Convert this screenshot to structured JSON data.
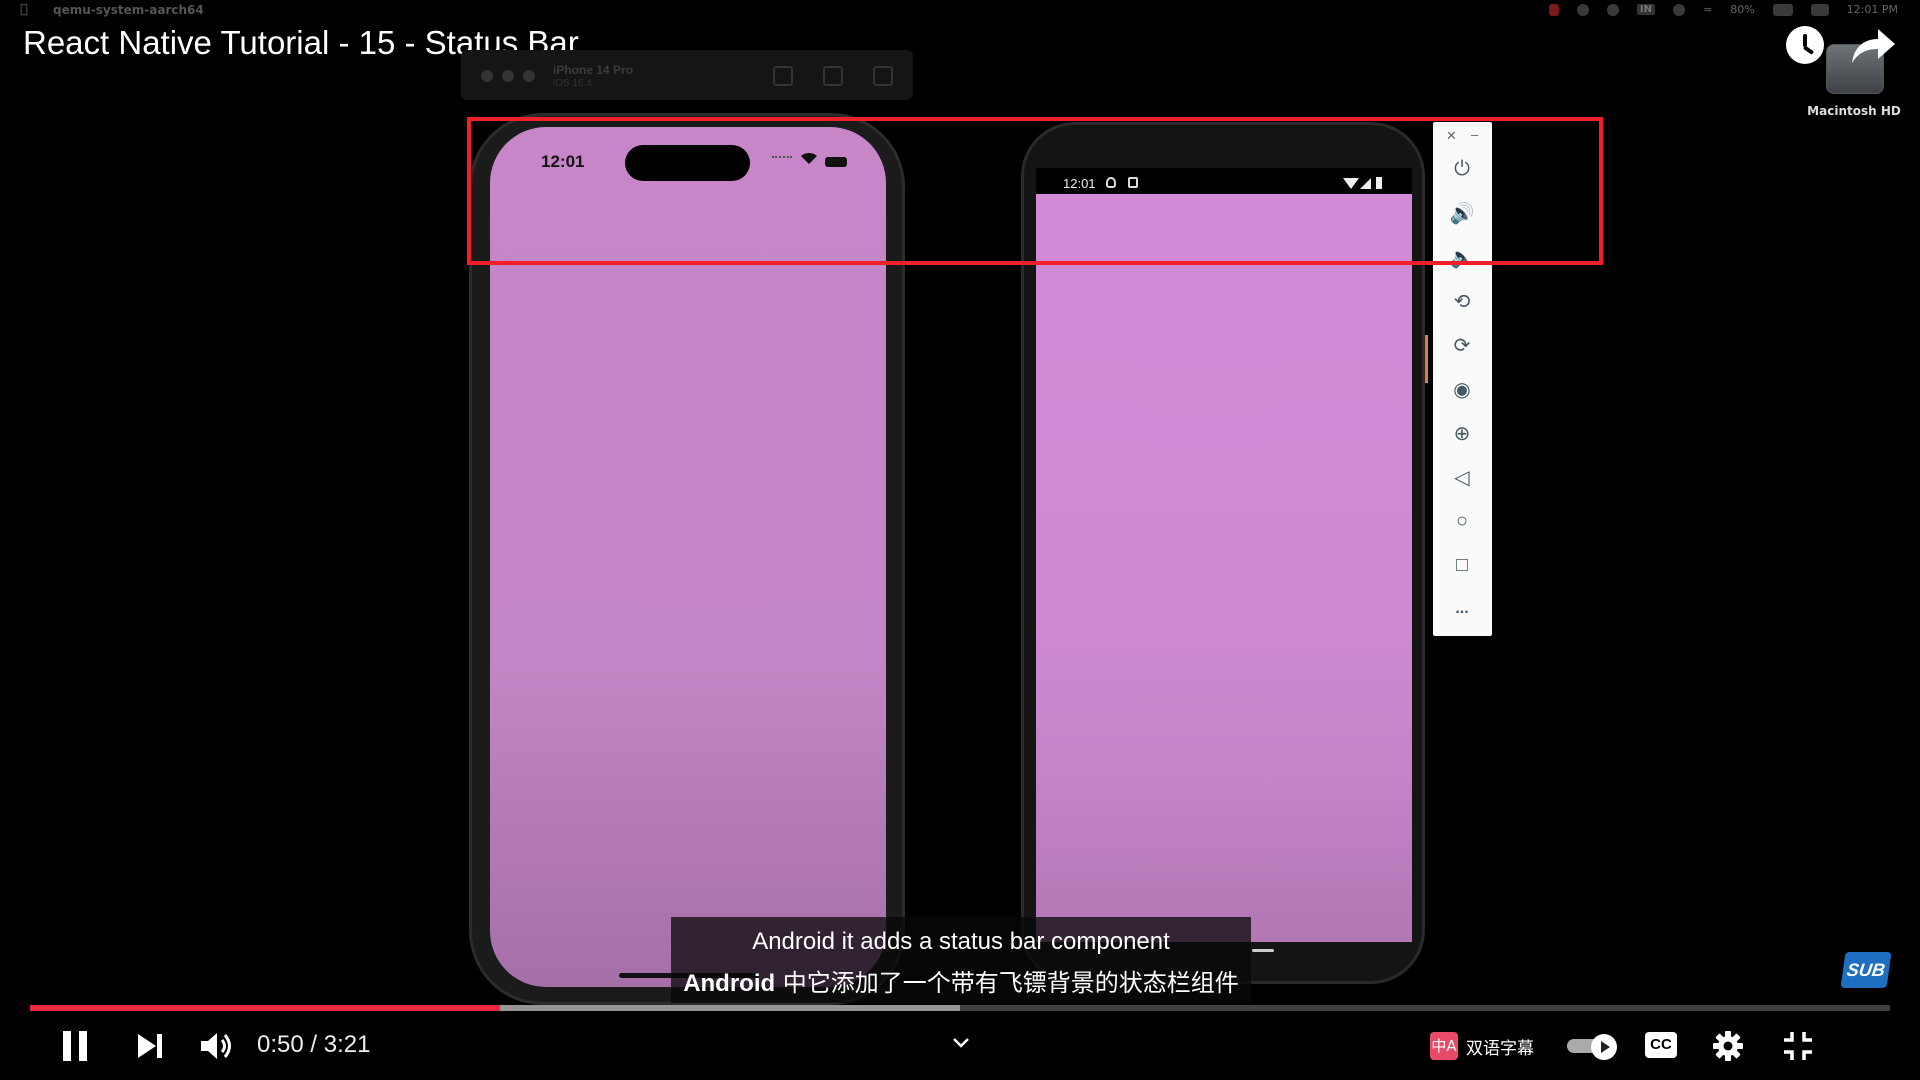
{
  "menubar": {
    "app_name": "qemu-system-aarch64",
    "battery": "80%",
    "clock": "12:01 PM",
    "input_indicator": "IN"
  },
  "video": {
    "title": "React Native Tutorial - 15 - Status Bar"
  },
  "desktop": {
    "drive_label": "Macintosh HD"
  },
  "simulator": {
    "device_name": "iPhone 14 Pro",
    "os_version": "iOS 16.4",
    "ios_time": "12:01"
  },
  "android": {
    "time": "12:01",
    "panel_more": "..."
  },
  "subtitles": {
    "english": "Android it adds a status bar component",
    "chinese_prefix": "Android",
    "chinese_rest": " 中它添加了一个带有飞镖背景的状态栏组件"
  },
  "badge": {
    "sub_label": "SUB"
  },
  "player": {
    "current_time": "0:50",
    "duration": "3:21",
    "time_display": "0:50 / 3:21",
    "progress_played_fraction": 0.2527,
    "progress_buffered_fraction": 0.5,
    "dual_subtitle_icon": "中A",
    "dual_subtitle_label": "双语字幕",
    "cc_label": "CC",
    "autoplay_on": true
  },
  "colors": {
    "highlight_box": "#f01f29",
    "progress_played": "#f0263b",
    "ios_screen": "#c686c8",
    "android_screen": "#d38ad7"
  }
}
